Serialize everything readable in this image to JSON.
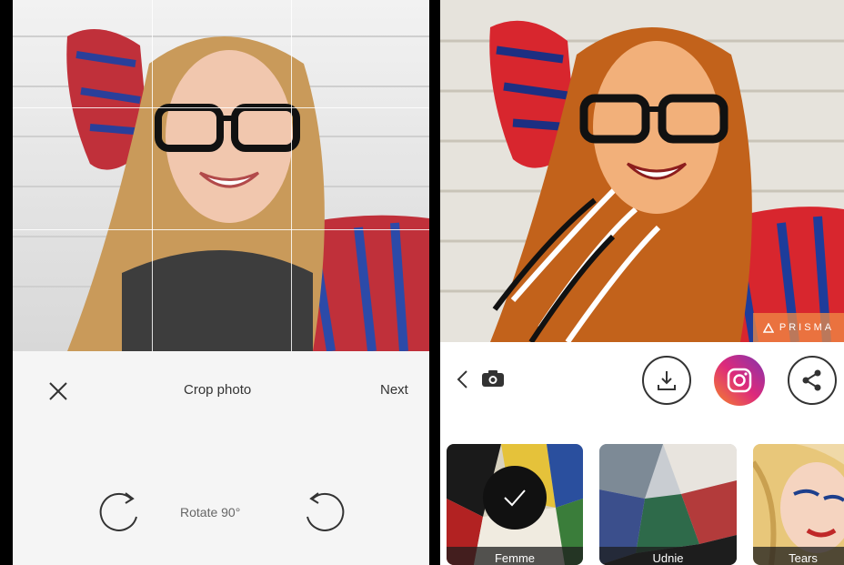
{
  "left_screen": {
    "toolbar": {
      "title": "Crop photo",
      "next_label": "Next"
    },
    "rotate": {
      "label": "Rotate 90°"
    }
  },
  "right_screen": {
    "watermark": "PRISMA",
    "filters": [
      {
        "label": "Femme",
        "selected": true
      },
      {
        "label": "Udnie",
        "selected": false
      },
      {
        "label": "Tears",
        "selected": false
      }
    ]
  },
  "colors": {
    "instagram_gradient_start": "#f58529",
    "instagram_gradient_end": "#8134af",
    "badge": "#f08c46"
  }
}
